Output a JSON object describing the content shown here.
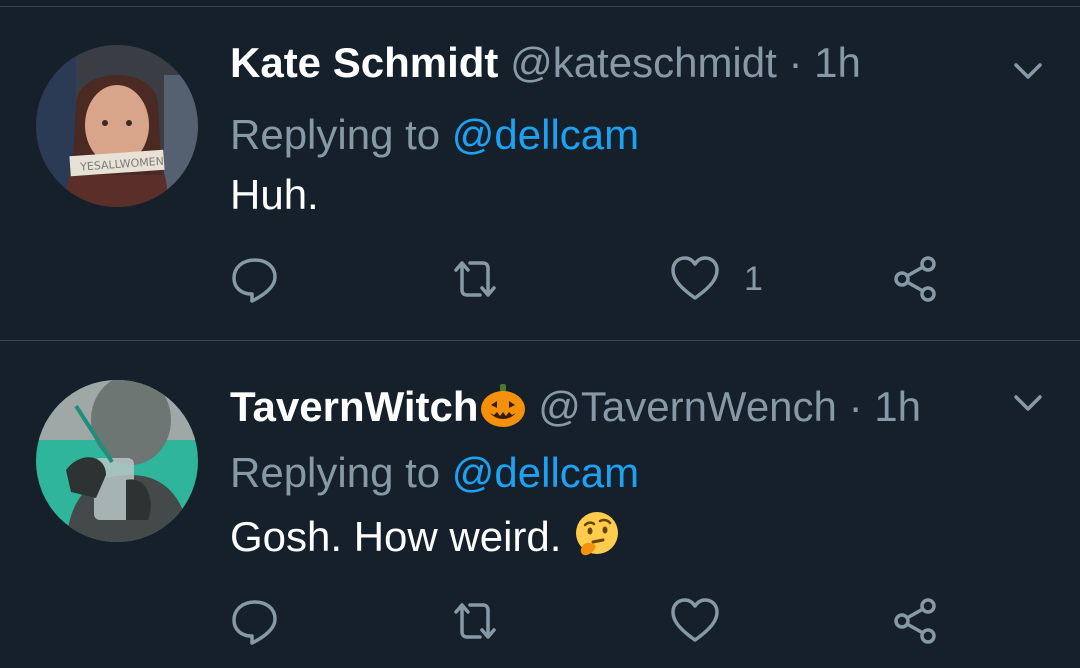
{
  "colors": {
    "background": "#15202b",
    "divider": "#38444d",
    "secondary_text": "#8899a6",
    "link": "#1da1f2",
    "primary_text": "#ffffff"
  },
  "tweets": [
    {
      "display_name": "Kate Schmidt",
      "display_name_emoji": "",
      "handle": "@kateschmidt",
      "separator": "·",
      "time": "1h",
      "replying_label": "Replying to",
      "replying_to": "@dellcam",
      "text": "Huh.",
      "text_emoji": "",
      "like_count": "1",
      "avatar_label": "YESALLWOMEN",
      "icons": {
        "reply": "reply-icon",
        "retweet": "retweet-icon",
        "like": "heart-icon",
        "share": "share-icon",
        "menu": "chevron-down-icon"
      }
    },
    {
      "display_name": "TavernWitch",
      "display_name_emoji": "jack-o-lantern",
      "handle": "@TavernWench",
      "separator": "·",
      "time": "1h",
      "replying_label": "Replying to",
      "replying_to": "@dellcam",
      "text": "Gosh. How weird.",
      "text_emoji": "thinking-face",
      "like_count": "",
      "icons": {
        "reply": "reply-icon",
        "retweet": "retweet-icon",
        "like": "heart-icon",
        "share": "share-icon",
        "menu": "chevron-down-icon"
      }
    }
  ]
}
